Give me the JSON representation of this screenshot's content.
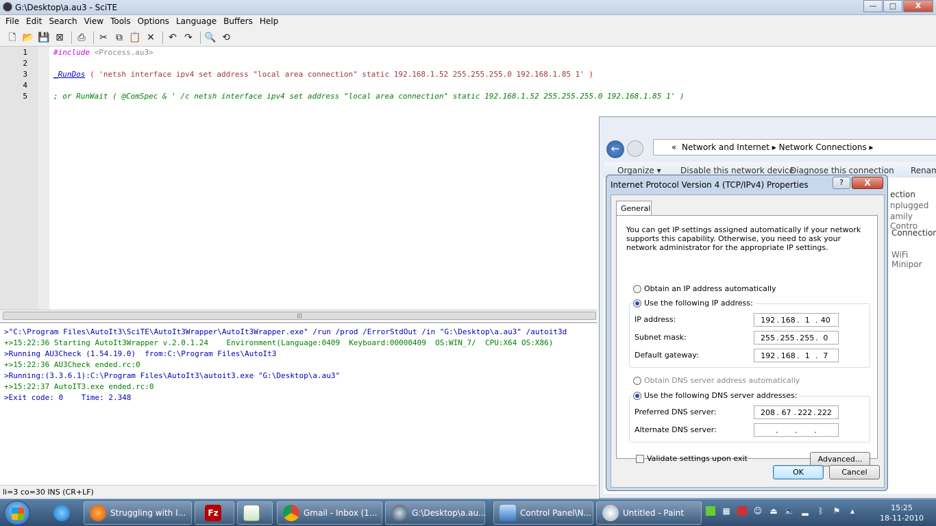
{
  "scite": {
    "title": "G:\\Desktop\\a.au3 - SciTE",
    "menus": [
      "File",
      "Edit",
      "Search",
      "View",
      "Tools",
      "Options",
      "Language",
      "Buffers",
      "Help"
    ],
    "window_buttons": {
      "minimize": "—",
      "maximize": "□",
      "close": "X"
    },
    "editor": {
      "line_numbers": [
        "1",
        "2",
        "3",
        "4",
        "5"
      ],
      "line1": {
        "directive": "#include",
        "target": " <Process.au3>"
      },
      "line3": {
        "func": "_RunDos",
        "open": " ( ",
        "string": "'netsh interface ipv4 set address \"local area connection\" static 192.168.1.52 255.255.255.0 192.168.1.85 1'",
        "close": " )"
      },
      "line5": {
        "comment": "; or RunWait ( @ComSpec & ' /c netsh interface ipv4 set address \"local area connection\" static 192.168.1.52 255.255.255.0 192.168.1.85 1' )"
      }
    },
    "output": [
      ">\"C:\\Program Files\\AutoIt3\\SciTE\\AutoIt3Wrapper\\AutoIt3Wrapper.exe\" /run /prod /ErrorStdOut /in \"G:\\Desktop\\a.au3\" /autoit3d",
      "+>15:22:36 Starting AutoIt3Wrapper v.2.0.1.24    Environment(Language:0409  Keyboard:00000409  OS:WIN_7/  CPU:X64 OS:X86)",
      ">Running AU3Check (1.54.19.0)  from:C:\\Program Files\\AutoIt3",
      "+>15:22:36 AU3Check ended.rc:0",
      ">Running:(3.3.6.1):C:\\Program Files\\AutoIt3\\autoit3.exe \"G:\\Desktop\\a.au3\"",
      "+>15:22:37 AutoIT3.exe ended.rc:0",
      ">Exit code: 0    Time: 2.348"
    ],
    "status": "li=3 co=30 INS (CR+LF)"
  },
  "network_window": {
    "breadcrumb_prefix": "«",
    "breadcrumb": [
      "Network and Internet",
      "Network Connections"
    ],
    "commands": [
      "Organize ▾",
      "Disable this network device",
      "Diagnose this connection",
      "Renam"
    ],
    "partial_items": [
      "ection",
      "nplugged",
      "amily Contro",
      "Connection",
      "WiFi Minipor"
    ]
  },
  "dialog": {
    "title": "Internet Protocol Version 4 (TCP/IPv4) Properties",
    "help_label": "?",
    "close_label": "X",
    "tab": "General",
    "description": "You can get IP settings assigned automatically if your network supports this capability. Otherwise, you need to ask your network administrator for the appropriate IP settings.",
    "radio_auto_ip": "Obtain an IP address automatically",
    "radio_manual_ip": "Use the following IP address:",
    "ip_label": "IP address:",
    "ip": [
      "192",
      "168",
      "1",
      "40"
    ],
    "subnet_label": "Subnet mask:",
    "subnet": [
      "255",
      "255",
      "255",
      "0"
    ],
    "gateway_label": "Default gateway:",
    "gateway": [
      "192",
      "168",
      "1",
      "7"
    ],
    "radio_auto_dns": "Obtain DNS server address automatically",
    "radio_manual_dns": "Use the following DNS server addresses:",
    "pref_dns_label": "Preferred DNS server:",
    "pref_dns": [
      "208",
      "67",
      "222",
      "222"
    ],
    "alt_dns_label": "Alternate DNS server:",
    "alt_dns": [
      "",
      "",
      "",
      ""
    ],
    "validate_label": "Validate settings upon exit",
    "advanced_label": "Advanced...",
    "ok_label": "OK",
    "cancel_label": "Cancel"
  },
  "taskbar": {
    "items": [
      {
        "label": "Struggling with I...",
        "icon": "firefox-icon"
      },
      {
        "label": "",
        "icon": "filezilla-icon"
      },
      {
        "label": "",
        "icon": "notepad-icon"
      },
      {
        "label": "Gmail - Inbox (1...",
        "icon": "chrome-icon"
      },
      {
        "label": "G:\\Desktop\\a.au...",
        "icon": "scite-icon"
      },
      {
        "label": "Control Panel\\N...",
        "icon": "control-panel-icon"
      },
      {
        "label": "Untitled - Paint",
        "icon": "paint-icon"
      }
    ],
    "time": "15:25",
    "date": "18-11-2010"
  }
}
